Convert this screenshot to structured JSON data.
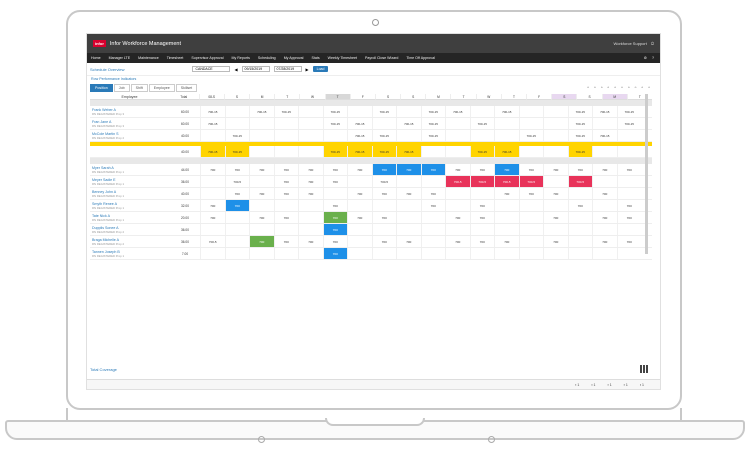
{
  "app": {
    "logo": "infor",
    "title": "Infor Workforce Management",
    "user": "Workforce Support"
  },
  "nav": [
    "Home",
    "Manager LTE",
    "Maintenance",
    "Timesheet",
    "Supervisor Approval",
    "My Reports",
    "Scheduling",
    "My Approval",
    "Stats",
    "Weekly Timesheet",
    "Payroll Close Wizard",
    "Time Off Approval"
  ],
  "toolbar": {
    "link": "Schedule Overview",
    "select": "CANDACE",
    "start_date": "09/15/2019",
    "end_date": "07/28/2019",
    "load_label": "Load",
    "subtitle": "Row Performance Indicators"
  },
  "tabs": [
    "Position",
    "Job",
    "Shift",
    "Employee",
    "Skillset"
  ],
  "grid": {
    "employee_header": "Employee",
    "total_header": "Total",
    "days": [
      "08-S",
      "S",
      "M",
      "T",
      "W",
      "T",
      "F",
      "S",
      "S",
      "M",
      "T",
      "W",
      "T",
      "F",
      "S",
      "S",
      "M",
      "T"
    ],
    "rows": [
      {
        "name": "Frank Weber A",
        "sub": "RN REGISTERED Prop 3",
        "total": "60.00",
        "cells": [
          "700-15",
          "",
          "700-15",
          "700-15",
          "",
          "700-15",
          "",
          "700-15",
          "",
          "700-15",
          "700-15",
          "",
          "700-15",
          "",
          "",
          "700-15",
          "700-15",
          "700-15"
        ],
        "colors": []
      },
      {
        "name": "Fran Jane A",
        "sub": "RN REGISTERED Prop 3",
        "total": "60.00",
        "cells": [
          "700-15",
          "",
          "",
          "",
          "",
          "700-15",
          "700-15",
          "",
          "700-15",
          "700-15",
          "",
          "700-15",
          "",
          "",
          "",
          "700-15",
          "",
          "700-15"
        ],
        "colors": []
      },
      {
        "name": "McCole Martin S",
        "sub": "RN REGISTERED Prop 2",
        "total": "40.00",
        "cells": [
          "",
          "700-15",
          "",
          "",
          "",
          "",
          "700-15",
          "700-15",
          "",
          "700-15",
          "",
          "",
          "",
          "700-15",
          "",
          "700-15",
          "700-15",
          ""
        ],
        "colors": []
      },
      {
        "name": "",
        "sub": "",
        "total": "40.00",
        "cells": [
          "700-15",
          "700-15",
          "",
          "",
          "",
          "700-15",
          "700-15",
          "700-15",
          "700-15",
          "",
          "",
          "700-15",
          "700-15",
          "",
          "",
          "700-15",
          "",
          ""
        ],
        "colors": [
          "y",
          "y",
          "",
          "",
          "",
          "y",
          "y",
          "y",
          "y",
          "",
          "",
          "y",
          "y",
          "",
          "",
          "y",
          "",
          ""
        ]
      },
      {
        "name": "Myer Sarah A",
        "sub": "RN REGISTERED Prop 1",
        "total": "44.00",
        "cells": [
          "700",
          "700",
          "700",
          "700",
          "700",
          "700",
          "700",
          "700",
          "700",
          "700",
          "700",
          "700",
          "700",
          "700",
          "700",
          "700",
          "700",
          "700"
        ],
        "colors": [
          "",
          "",
          "",
          "",
          "",
          "",
          "",
          "b",
          "b",
          "b",
          "",
          "",
          "b",
          "",
          "",
          "",
          "",
          ""
        ]
      },
      {
        "name": "Meyer Sadie E",
        "sub": "RN REGISTERED Prop 1",
        "total": "36.00",
        "cells": [
          "",
          "700-5",
          "",
          "700",
          "700",
          "700",
          "",
          "700-5",
          "",
          "",
          "700-5",
          "700-5",
          "700-5",
          "700-5",
          "",
          "700-5",
          "",
          ""
        ],
        "colors": [
          "",
          "",
          "",
          "",
          "",
          "",
          "",
          "",
          "",
          "",
          "r",
          "r",
          "r",
          "r",
          "",
          "r",
          "",
          ""
        ]
      },
      {
        "name": "Benney John A",
        "sub": "RN REGISTERED Prop 1",
        "total": "40.00",
        "cells": [
          "",
          "700",
          "700",
          "700",
          "700",
          "",
          "700",
          "700",
          "700",
          "700",
          "",
          "",
          "700",
          "700",
          "700",
          "",
          "700",
          ""
        ],
        "colors": []
      },
      {
        "name": "Smyth Renee A",
        "sub": "RN REGISTERED Prop 1",
        "total": "32.00",
        "cells": [
          "700",
          "700",
          "",
          "",
          "",
          "700",
          "",
          "",
          "",
          "700",
          "",
          "700",
          "",
          "",
          "",
          "700",
          "",
          "700"
        ],
        "colors": [
          "",
          "b",
          "",
          "",
          "",
          "",
          "",
          "",
          "",
          "",
          "",
          "",
          "",
          "",
          "",
          "",
          "",
          ""
        ]
      },
      {
        "name": "Tate Nick A",
        "sub": "RN REGISTERED Prop 1",
        "total": "20.00",
        "cells": [
          "700",
          "",
          "700",
          "700",
          "",
          "700",
          "700",
          "700",
          "",
          "",
          "700",
          "700",
          "",
          "",
          "700",
          "",
          "700",
          "700"
        ],
        "colors": [
          "",
          "",
          "",
          "",
          "",
          "g",
          "",
          "",
          "",
          "",
          "",
          "",
          "",
          "",
          "",
          "",
          "",
          ""
        ]
      },
      {
        "name": "Dupplis Sonee A",
        "sub": "RN REGISTERED Prop 2",
        "total": "36.00",
        "cells": [
          "",
          "",
          "",
          "",
          "",
          "700",
          "",
          "",
          "",
          "",
          "",
          "",
          "",
          "",
          "",
          "",
          "",
          ""
        ],
        "colors": [
          "",
          "",
          "",
          "",
          "",
          "b",
          "",
          "",
          "",
          "",
          "",
          "",
          "",
          "",
          "",
          "",
          "",
          ""
        ]
      },
      {
        "name": "Braga Michelle A",
        "sub": "RN REGISTERED Prop 2",
        "total": "36.00",
        "cells": [
          "700-5",
          "",
          "700",
          "700",
          "700",
          "700",
          "",
          "700",
          "700",
          "",
          "700",
          "700",
          "700",
          "",
          "700",
          "",
          "700",
          "700"
        ],
        "colors": [
          "",
          "",
          "g",
          "",
          "",
          "",
          "",
          "",
          "",
          "",
          "",
          "",
          "",
          "",
          "",
          "",
          "",
          ""
        ]
      },
      {
        "name": "Tannen Joseph B",
        "sub": "RN REGISTERED Prop 1",
        "total": "7.00",
        "cells": [
          "",
          "",
          "",
          "",
          "",
          "700",
          "",
          "",
          "",
          "",
          "",
          "",
          "",
          "",
          "",
          "",
          "",
          ""
        ],
        "colors": [
          "",
          "",
          "",
          "",
          "",
          "b",
          "",
          "",
          "",
          "",
          "",
          "",
          "",
          "",
          "",
          "",
          "",
          ""
        ]
      }
    ]
  },
  "footer": {
    "link": "Total Coverage"
  },
  "status": [
    "1",
    "1",
    "1",
    "1",
    "1"
  ]
}
